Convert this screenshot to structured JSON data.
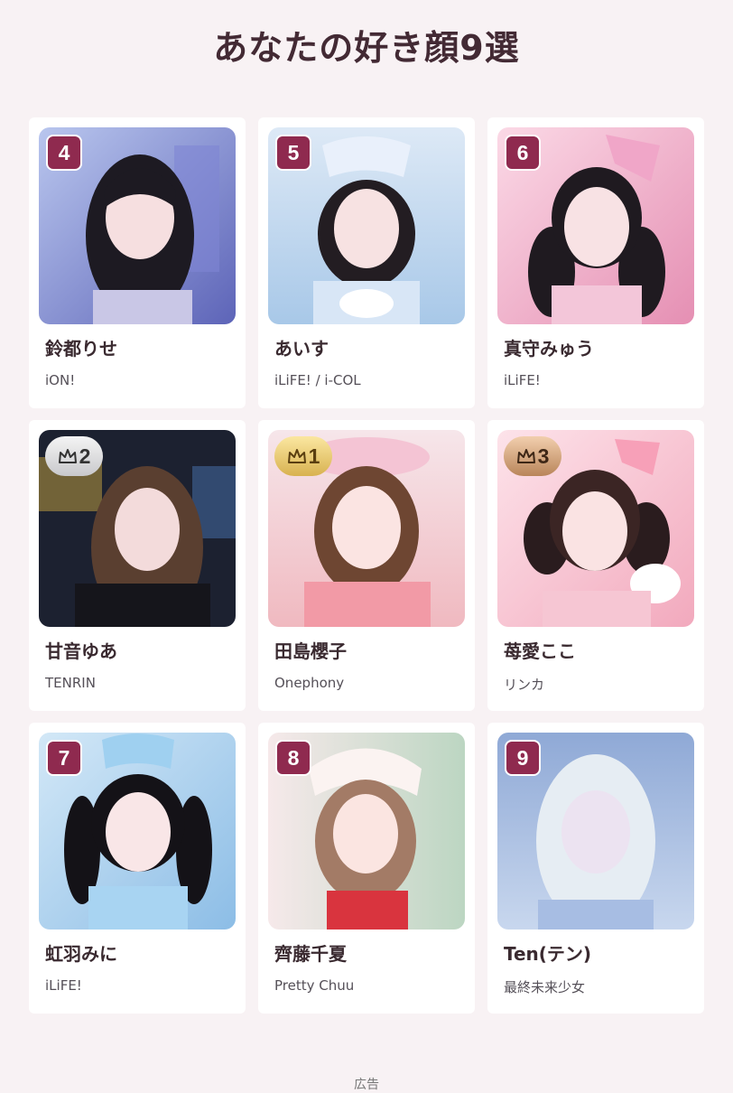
{
  "title": "あなたの好き顔9選",
  "cards": [
    {
      "rank": "4",
      "name": "鈴都りせ",
      "group": "iON!"
    },
    {
      "rank": "5",
      "name": "あいす",
      "group": "iLiFE! / i-COL"
    },
    {
      "rank": "6",
      "name": "真守みゅう",
      "group": "iLiFE!"
    },
    {
      "rank": "2",
      "name": "甘音ゆあ",
      "group": "TENRIN",
      "crown": "silver"
    },
    {
      "rank": "1",
      "name": "田島櫻子",
      "group": "Onephony",
      "crown": "gold"
    },
    {
      "rank": "3",
      "name": "苺愛ここ",
      "group": "リンカ",
      "crown": "bronze"
    },
    {
      "rank": "7",
      "name": "虹羽みに",
      "group": "iLiFE!"
    },
    {
      "rank": "8",
      "name": "齊藤千夏",
      "group": "Pretty Chuu"
    },
    {
      "rank": "9",
      "name": "Ten(テン)",
      "group": "最終未来少女"
    }
  ],
  "footer": {
    "ad_label": "広告"
  },
  "colors": {
    "background": "#f8f2f4",
    "title": "#432a34",
    "rank_badge": "#8f2a4f",
    "crown_gold": "#d8b250",
    "crown_silver": "#c9c9cc",
    "crown_bronze": "#b9855a"
  },
  "icons": {
    "crown": "crown-icon"
  }
}
